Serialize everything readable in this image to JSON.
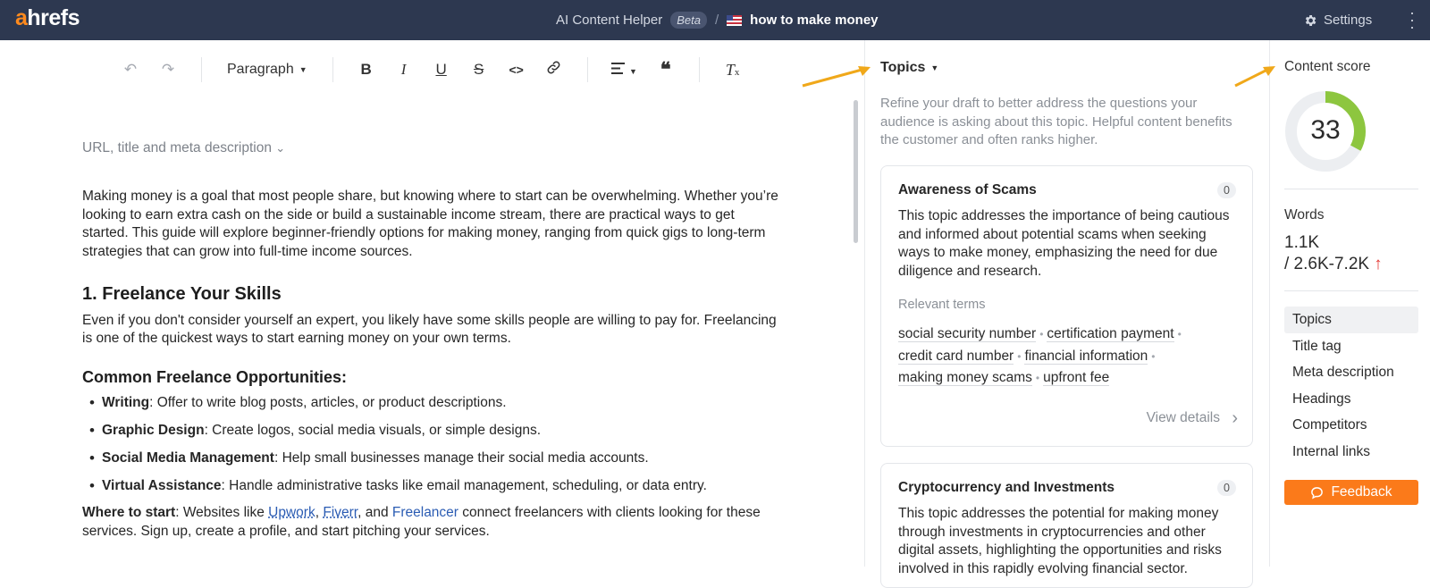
{
  "header": {
    "logo_a": "a",
    "logo_rest": "hrefs",
    "helper": "AI Content Helper",
    "beta": "Beta",
    "separator": "/",
    "document": "how to make money",
    "settings": "Settings"
  },
  "toolbar": {
    "undo_icon": "undo-icon",
    "redo_icon": "redo-icon",
    "block_style": "Paragraph",
    "bold": "B",
    "italic": "I",
    "underline": "U",
    "strike": "S",
    "code": "<>",
    "quote": "❝",
    "clear": "T"
  },
  "editor": {
    "meta_toggle": "URL, title and meta description",
    "intro": "Making money is a goal that most people share, but knowing where to start can be overwhelming. Whether you’re looking to earn extra cash on the side or build a sustainable income stream, there are practical ways to get started. This guide will explore beginner-friendly options for making money, ranging from quick gigs to long-term strategies that can grow into full-time income sources.",
    "h1": "1. Freelance Your Skills",
    "p2": "Even if you don't consider yourself an expert, you likely have some skills people are willing to pay for. Freelancing is one of the quickest ways to start earning money on your own terms.",
    "h2": "Common Freelance Opportunities:",
    "bullets": [
      {
        "strong": "Writing",
        "text": ": Offer to write blog posts, articles, or product descriptions."
      },
      {
        "strong": "Graphic Design",
        "text": ": Create logos, social media visuals, or simple designs."
      },
      {
        "strong": "Social Media Management",
        "text": ": Help small businesses manage their social media accounts."
      },
      {
        "strong": "Virtual Assistance",
        "text": ": Handle administrative tasks like email management, scheduling, or data entry."
      }
    ],
    "where_strong": "Where to start",
    "where_1": ": Websites like ",
    "link_upwork": "Upwork",
    "comma1": ", ",
    "link_fiverr": "Fiverr",
    "comma2": ", and ",
    "link_freelancer": "Freelancer",
    "where_2": " connect freelancers with clients looking for these services. Sign up, create a profile, and start pitching your services."
  },
  "topics": {
    "heading": "Topics",
    "description": "Refine your draft to better address the questions your audience is asking about this topic. Helpful content benefits the customer and often ranks higher.",
    "cards": [
      {
        "title": "Awareness of Scams",
        "count": "0",
        "description": "This topic addresses the importance of being cautious and informed about potential scams when seeking ways to make money, emphasizing the need for due diligence and research.",
        "relevant_label": "Relevant terms",
        "terms": [
          "social security number",
          "certification payment",
          "credit card number",
          "financial information",
          "making money scams",
          "upfront fee"
        ],
        "view_details": "View details"
      },
      {
        "title": "Cryptocurrency and Investments",
        "count": "0",
        "description": "This topic addresses the potential for making money through investments in cryptocurrencies and other digital assets, highlighting the opportunities and risks involved in this rapidly evolving financial sector."
      }
    ]
  },
  "rail": {
    "score_label": "Content score",
    "score": "33",
    "score_fraction": 0.33,
    "score_color": "#8dc63f",
    "words_label": "Words",
    "words_current": "1.1K",
    "words_target": "/ 2.6K-7.2K",
    "nav": [
      "Topics",
      "Title tag",
      "Meta description",
      "Headings",
      "Competitors",
      "Internal links"
    ],
    "feedback": "Feedback"
  }
}
